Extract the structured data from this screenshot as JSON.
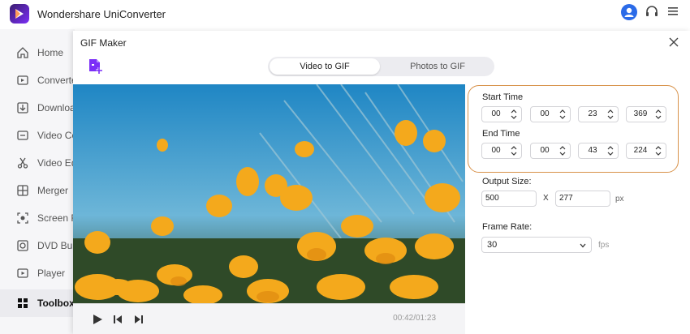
{
  "app": {
    "title": "Wondershare UniConverter"
  },
  "titlebar": {
    "user_icon": "user-icon",
    "support_icon": "headset-icon",
    "menu_icon": "menu-icon"
  },
  "sidebar": {
    "items": [
      {
        "label": "Home",
        "icon": "home-icon"
      },
      {
        "label": "Converter",
        "icon": "converter-icon"
      },
      {
        "label": "Downloader",
        "icon": "download-icon"
      },
      {
        "label": "Video Compressor",
        "icon": "compress-icon"
      },
      {
        "label": "Video Editor",
        "icon": "scissors-icon"
      },
      {
        "label": "Merger",
        "icon": "merge-icon"
      },
      {
        "label": "Screen Recorder",
        "icon": "record-icon"
      },
      {
        "label": "DVD Burner",
        "icon": "disc-icon"
      },
      {
        "label": "Player",
        "icon": "play-icon"
      },
      {
        "label": "Toolbox",
        "icon": "grid-icon",
        "active": true
      }
    ]
  },
  "dialog": {
    "title": "GIF Maker",
    "tabs": [
      {
        "label": "Video to GIF",
        "active": true
      },
      {
        "label": "Photos to GIF",
        "active": false
      }
    ],
    "player": {
      "time": "00:42/01:23"
    },
    "start_time": {
      "label": "Start Time",
      "hh": "00",
      "mm": "00",
      "ss": "23",
      "ms": "369"
    },
    "end_time": {
      "label": "End Time",
      "hh": "00",
      "mm": "00",
      "ss": "43",
      "ms": "224"
    },
    "output_size": {
      "label": "Output Size:",
      "width": "500",
      "separator": "X",
      "height": "277",
      "unit": "px"
    },
    "frame_rate": {
      "label": "Frame Rate:",
      "value": "30",
      "unit": "fps"
    }
  },
  "colors": {
    "accent": "#7b2ff7",
    "highlight_ring": "#d8924a",
    "brand_blue": "#2b6be8"
  }
}
